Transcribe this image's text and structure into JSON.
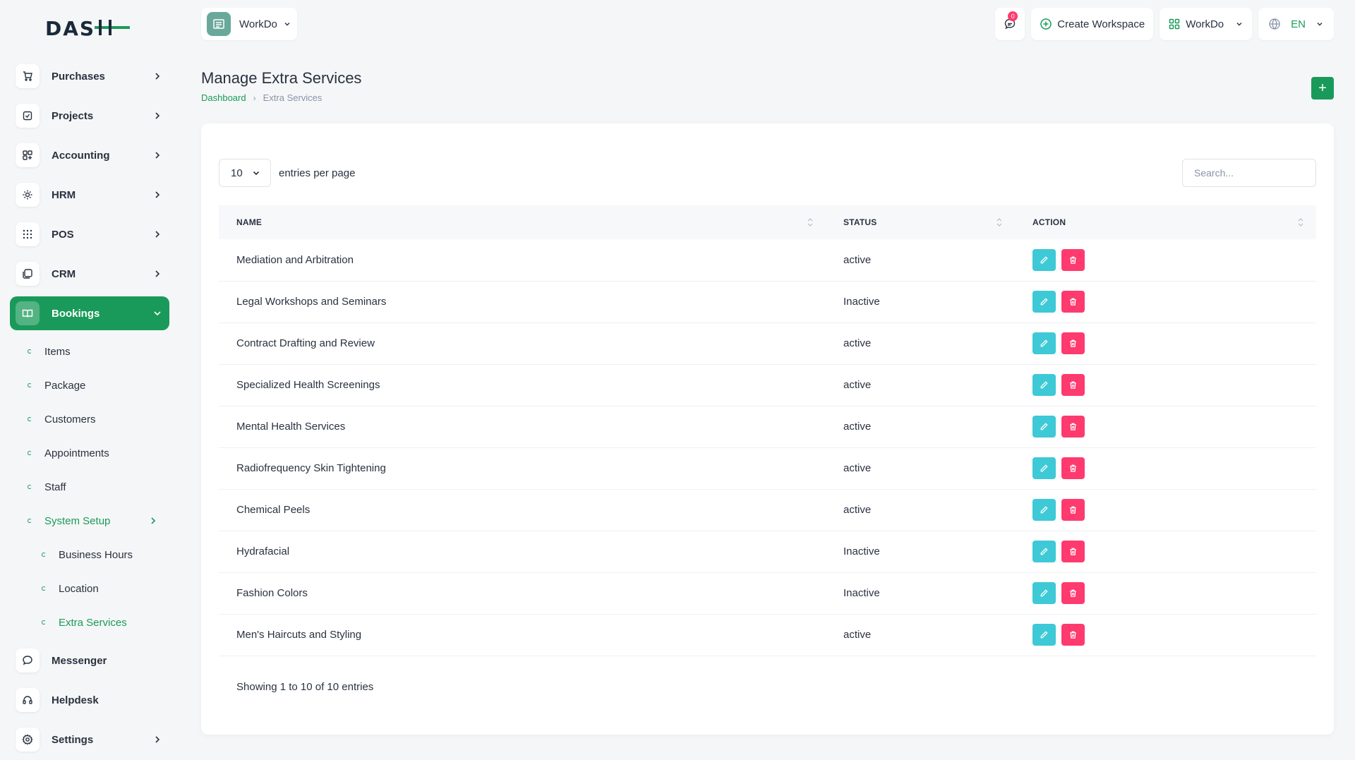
{
  "brand": {
    "logo_text": "DASH",
    "accent": "#1a9a5a"
  },
  "sidebar": {
    "items": [
      {
        "label": "Purchases",
        "icon": "cart-icon"
      },
      {
        "label": "Projects",
        "icon": "checklist-icon"
      },
      {
        "label": "Accounting",
        "icon": "grid-icon"
      },
      {
        "label": "HRM",
        "icon": "hrm-icon"
      },
      {
        "label": "POS",
        "icon": "dots-grid-icon"
      },
      {
        "label": "CRM",
        "icon": "layers-icon"
      },
      {
        "label": "Bookings",
        "icon": "book-icon"
      },
      {
        "label": "Messenger",
        "icon": "chat-icon"
      },
      {
        "label": "Helpdesk",
        "icon": "headset-icon"
      },
      {
        "label": "Settings",
        "icon": "gear-icon"
      }
    ],
    "bookings_sub": [
      "Items",
      "Package",
      "Customers",
      "Appointments",
      "Staff",
      "System Setup"
    ],
    "system_setup_sub": [
      "Business Hours",
      "Location",
      "Extra Services"
    ]
  },
  "topbar": {
    "workspace_name": "WorkDo",
    "message_count": "0",
    "create_workspace": "Create Workspace",
    "user_workspace": "WorkDo",
    "language": "EN"
  },
  "page": {
    "title": "Manage Extra Services",
    "breadcrumb_home": "Dashboard",
    "breadcrumb_current": "Extra Services",
    "add_label": "+"
  },
  "table": {
    "per_page_value": "10",
    "per_page_label": "entries per page",
    "search_placeholder": "Search...",
    "headers": [
      "NAME",
      "STATUS",
      "ACTION"
    ],
    "rows": [
      {
        "name": "Mediation and Arbitration",
        "status": "active"
      },
      {
        "name": "Legal Workshops and Seminars",
        "status": "Inactive"
      },
      {
        "name": "Contract Drafting and Review",
        "status": "active"
      },
      {
        "name": "Specialized Health Screenings",
        "status": "active"
      },
      {
        "name": "Mental Health Services",
        "status": "active"
      },
      {
        "name": "Radiofrequency Skin Tightening",
        "status": "active"
      },
      {
        "name": "Chemical Peels",
        "status": "active"
      },
      {
        "name": "Hydrafacial",
        "status": "Inactive"
      },
      {
        "name": "Fashion Colors",
        "status": "Inactive"
      },
      {
        "name": "Men's Haircuts and Styling",
        "status": "active"
      }
    ],
    "footer": "Showing 1 to 10 of 10 entries"
  }
}
